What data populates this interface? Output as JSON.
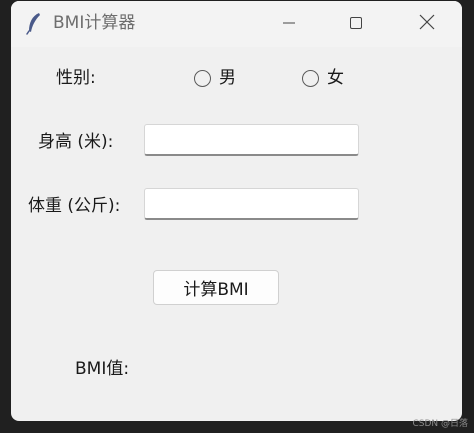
{
  "window": {
    "title": "BMI计算器",
    "app_icon": "feather-icon",
    "controls": {
      "minimize_icon": "minimize-icon",
      "maximize_icon": "maximize-icon",
      "close_icon": "close-icon"
    }
  },
  "form": {
    "gender_label": "性别:",
    "gender_options": [
      {
        "label": "男",
        "selected": false
      },
      {
        "label": "女",
        "selected": false
      }
    ],
    "height_label": "身高 (米):",
    "height_value": "",
    "weight_label": "体重 (公斤):",
    "weight_value": "",
    "calculate_button": "计算BMI",
    "result_label": "BMI值:"
  },
  "watermark": "CSDN @日落"
}
